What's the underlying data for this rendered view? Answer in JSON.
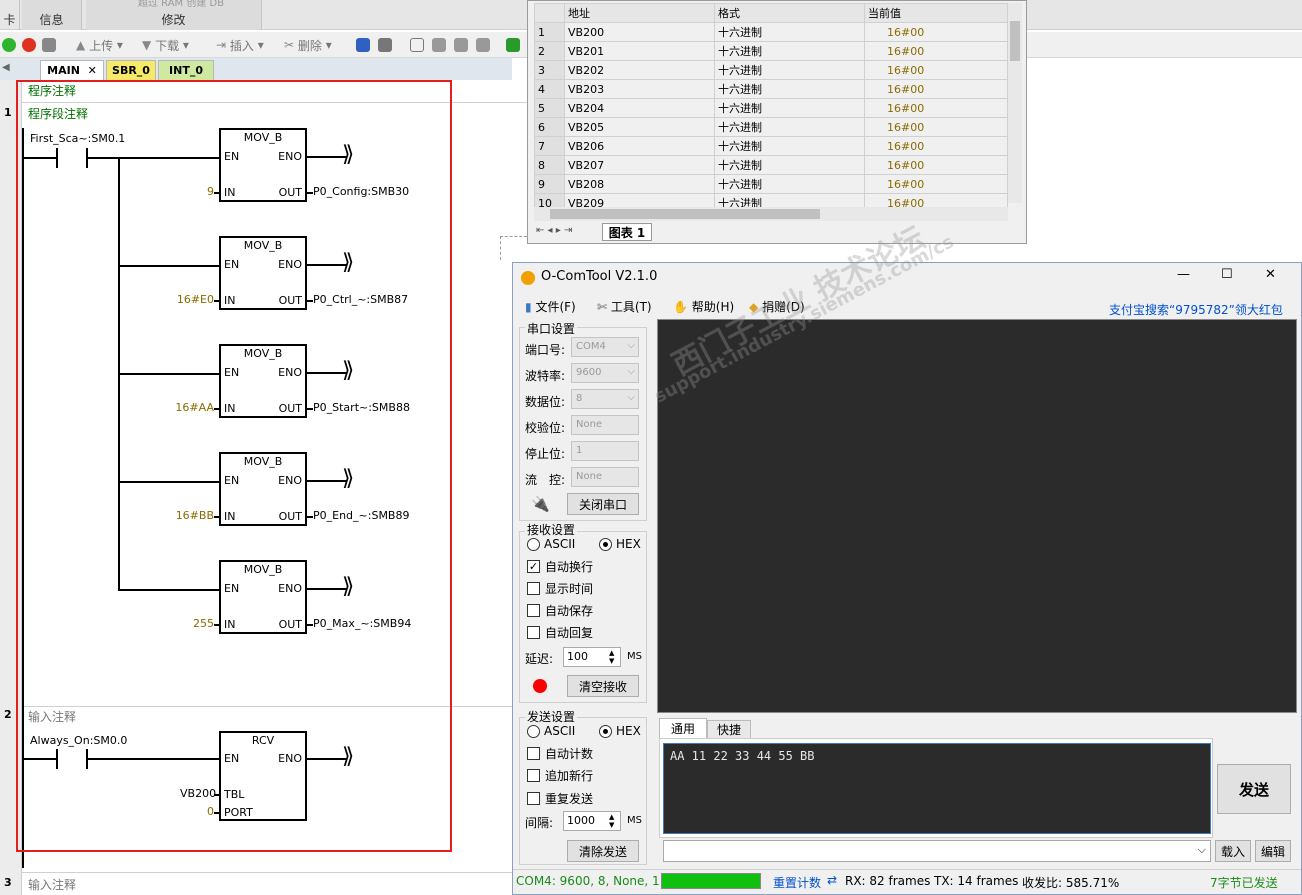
{
  "ribbon": {
    "groups": [
      "卡",
      "信息",
      "修改"
    ],
    "faded_item": "超过 RAM 创建 DB"
  },
  "toolbar": {
    "upload": "上传",
    "download": "下载",
    "insert": "插入",
    "delete": "删除"
  },
  "editor_tabs": [
    "MAIN",
    "SBR_0",
    "INT_0"
  ],
  "program": {
    "comment": "程序注释",
    "networks": [
      {
        "number": "1",
        "comment": "程序段注释",
        "contact": "First_Sca~:SM0.1",
        "blocks": [
          {
            "name": "MOV_B",
            "in": "9",
            "out": "P0_Config:SMB30"
          },
          {
            "name": "MOV_B",
            "in": "16#E0",
            "out": "P0_Ctrl_~:SMB87"
          },
          {
            "name": "MOV_B",
            "in": "16#AA",
            "out": "P0_Start~:SMB88"
          },
          {
            "name": "MOV_B",
            "in": "16#BB",
            "out": "P0_End_~:SMB89"
          },
          {
            "name": "MOV_B",
            "in": "255",
            "out": "P0_Max_~:SMB94"
          }
        ]
      },
      {
        "number": "2",
        "comment": "输入注释",
        "contact": "Always_On:SM0.0",
        "block": {
          "name": "RCV",
          "tbl": "VB200",
          "port": "0"
        }
      },
      {
        "number": "3",
        "comment": "输入注释"
      }
    ],
    "pins": {
      "en": "EN",
      "eno": "ENO",
      "in": "IN",
      "out": "OUT",
      "tbl": "TBL",
      "port": "PORT"
    }
  },
  "status_chart": {
    "headers": [
      "地址",
      "格式",
      "当前值"
    ],
    "rows": [
      {
        "n": "1",
        "addr": "VB200",
        "fmt": "十六进制",
        "val": "16#00"
      },
      {
        "n": "2",
        "addr": "VB201",
        "fmt": "十六进制",
        "val": "16#00"
      },
      {
        "n": "3",
        "addr": "VB202",
        "fmt": "十六进制",
        "val": "16#00"
      },
      {
        "n": "4",
        "addr": "VB203",
        "fmt": "十六进制",
        "val": "16#00"
      },
      {
        "n": "5",
        "addr": "VB204",
        "fmt": "十六进制",
        "val": "16#00"
      },
      {
        "n": "6",
        "addr": "VB205",
        "fmt": "十六进制",
        "val": "16#00"
      },
      {
        "n": "7",
        "addr": "VB206",
        "fmt": "十六进制",
        "val": "16#00"
      },
      {
        "n": "8",
        "addr": "VB207",
        "fmt": "十六进制",
        "val": "16#00"
      },
      {
        "n": "9",
        "addr": "VB208",
        "fmt": "十六进制",
        "val": "16#00"
      },
      {
        "n": "10",
        "addr": "VB209",
        "fmt": "十六进制",
        "val": "16#00"
      }
    ],
    "sheet_tab": "图表 1"
  },
  "comtool": {
    "title": "O-ComTool V2.1.0",
    "menu": {
      "file": "文件(F)",
      "tools": "工具(T)",
      "help": "帮助(H)",
      "donate": "捐赠(D)",
      "promo": "支付宝搜索“9795782”领大红包"
    },
    "serial": {
      "title": "串口设置",
      "port_label": "端口号:",
      "port": "COM4",
      "baud_label": "波特率:",
      "baud": "9600",
      "data_label": "数据位:",
      "data": "8",
      "parity_label": "校验位:",
      "parity": "None",
      "stop_label": "停止位:",
      "stop": "1",
      "flow_label": "流　控:",
      "flow": "None",
      "close_button": "关闭串口"
    },
    "receive": {
      "title": "接收设置",
      "ascii": "ASCII",
      "hex": "HEX",
      "auto_wrap": "自动换行",
      "show_time": "显示时间",
      "auto_save": "自动保存",
      "auto_reply": "自动回复",
      "delay_label": "延迟:",
      "delay": "100",
      "ms": "MS",
      "clear_button": "清空接收"
    },
    "send": {
      "title": "发送设置",
      "ascii": "ASCII",
      "hex": "HEX",
      "auto_count": "自动计数",
      "append_newline": "追加新行",
      "repeat_send": "重复发送",
      "interval_label": "间隔:",
      "interval": "1000",
      "ms": "MS",
      "clear_button": "清除发送"
    },
    "send_tabs": [
      "通用",
      "快捷"
    ],
    "send_text": "AA 11 22 33 44 55 BB",
    "send_button": "发送",
    "load_button": "载入",
    "edit_button": "编辑",
    "status": {
      "port": "COM4: 9600, 8, None, 1",
      "reset": "重置计数",
      "rx": "RX: 82 frames",
      "tx": "TX: 14 frames",
      "ratio": "收发比:  585.71%",
      "sent": "7字节已发送"
    },
    "window_controls": [
      "—",
      "☐",
      "✕"
    ]
  },
  "watermark": {
    "cn": "西门子工业 技术论坛",
    "url": "support.industry.siemens.com/cs"
  },
  "colors": {
    "selection": "#e02020",
    "comment": "#007000",
    "value": "#8a6b00",
    "recv_bg": "#2b2b2b",
    "status_green": "#1a8a1a",
    "progress": "#10c010",
    "link": "#0050d0"
  }
}
